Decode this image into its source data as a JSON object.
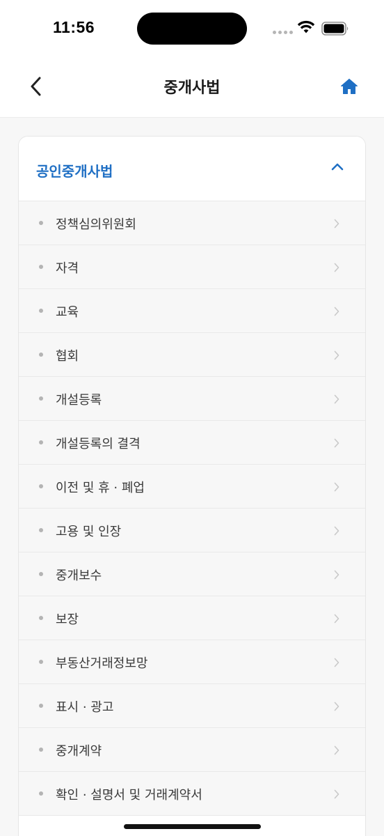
{
  "status_bar": {
    "time": "11:56",
    "icons": [
      "signal-dots-icon",
      "wifi-icon",
      "battery-icon"
    ]
  },
  "header": {
    "title": "중개사법",
    "back_icon": "chevron-left-icon",
    "home_icon": "home-icon",
    "home_color": "#1f6fc4"
  },
  "section": {
    "title": "공인중개사법",
    "expanded": true,
    "accent_color": "#1f6fc4",
    "items": [
      {
        "label": "정책심의위원회"
      },
      {
        "label": "자격"
      },
      {
        "label": "교육"
      },
      {
        "label": "협회"
      },
      {
        "label": "개설등록"
      },
      {
        "label": "개설등록의 결격"
      },
      {
        "label": "이전 및 휴 · 폐업"
      },
      {
        "label": "고용 및 인장"
      },
      {
        "label": "중개보수"
      },
      {
        "label": "보장"
      },
      {
        "label": "부동산거래정보망"
      },
      {
        "label": "표시 · 광고"
      },
      {
        "label": "중개계약"
      },
      {
        "label": "확인 · 설명서 및 거래계약서"
      }
    ]
  }
}
